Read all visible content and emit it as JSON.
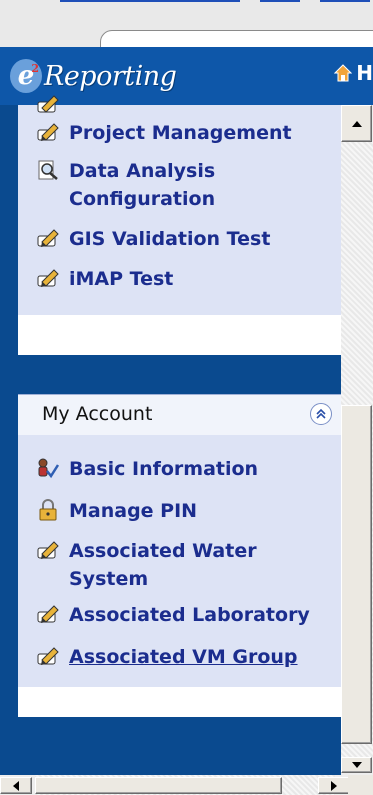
{
  "header": {
    "logo_letter": "e",
    "logo_superscript": "2",
    "logo_text": "Reporting",
    "home_label": "H"
  },
  "panel_one": {
    "items": [
      {
        "label": "Project Management",
        "icon": "pencil-icon"
      },
      {
        "label": "Data Analysis Configuration",
        "icon": "magnifier-document-icon"
      },
      {
        "label": "GIS Validation Test",
        "icon": "pencil-icon"
      },
      {
        "label": "iMAP Test",
        "icon": "pencil-icon"
      }
    ]
  },
  "my_account": {
    "title": "My Account",
    "items": [
      {
        "label": "Basic Information",
        "icon": "user-check-icon"
      },
      {
        "label": "Manage PIN",
        "icon": "lock-icon"
      },
      {
        "label": "Associated Water System",
        "icon": "pencil-icon"
      },
      {
        "label": "Associated Laboratory",
        "icon": "pencil-icon"
      },
      {
        "label": "Associated VM Group",
        "icon": "pencil-icon"
      }
    ]
  },
  "colors": {
    "header_blue": "#0e57a9",
    "page_blue": "#0a4a8f",
    "panel_bg": "#dde3f5",
    "link_text": "#1b2d8e"
  }
}
